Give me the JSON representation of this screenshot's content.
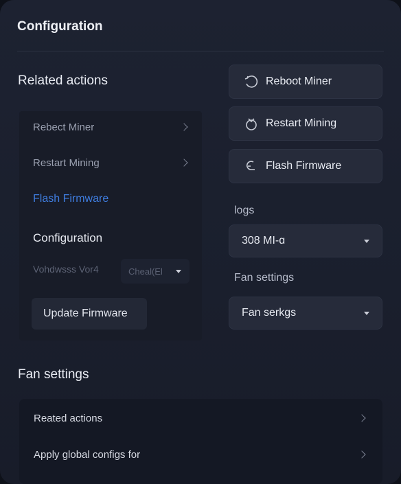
{
  "header": {
    "title": "Configuration"
  },
  "related": {
    "heading": "Related actions",
    "items": [
      {
        "label": "Rebect Miner"
      },
      {
        "label": "Restart Mining"
      },
      {
        "label": "Flash Firmware"
      }
    ],
    "config_heading": "Configuration",
    "field_label": "Vohdwsss Vor4",
    "field_select": "Cheal(El",
    "update_button": "Update Firmware"
  },
  "actions": {
    "buttons": [
      {
        "label": "Reboot Miner",
        "icon": "reboot-icon"
      },
      {
        "label": "Restart Mining",
        "icon": "restart-icon"
      },
      {
        "label": "Flash Firmware",
        "icon": "flash-icon"
      }
    ]
  },
  "logs": {
    "label": "logs",
    "value": "308 MI-ɑ"
  },
  "fan": {
    "label": "Fan settings",
    "value": "Fan serkgs"
  },
  "bottom": {
    "heading": "Fan settings",
    "rows": [
      {
        "label": "Reated actions"
      },
      {
        "label": "Apply global configs for"
      }
    ]
  },
  "colors": {
    "accent": "#3f7de0",
    "background": "#1d2231"
  }
}
